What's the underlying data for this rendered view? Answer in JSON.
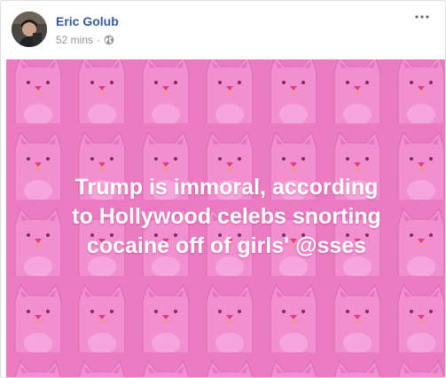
{
  "post": {
    "author": "Eric Golub",
    "time": "52 mins",
    "separator": "·",
    "privacy_icon": "globe-icon",
    "more_icon": "more-options-icon",
    "background_pattern": "pink-cat-pattern",
    "background_color": "#ec7cc2",
    "text_lines": [
      "Trump is immoral, according",
      "to Hollywood celebs snorting",
      "cocaine off of girls' @sses"
    ]
  }
}
